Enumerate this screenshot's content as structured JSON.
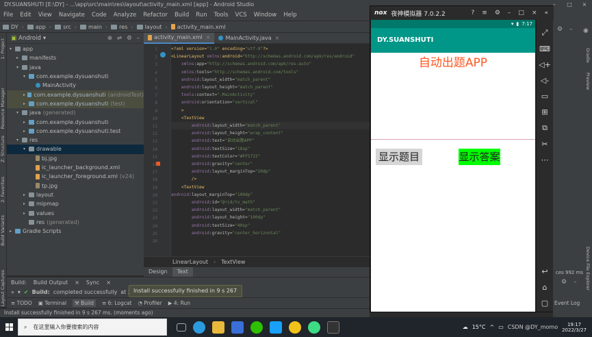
{
  "window": {
    "title": "DY.SUANSHUTI [E:\\DY] - ...\\app\\src\\main\\res\\layout\\activity_main.xml [app] - Android Studio"
  },
  "menu": [
    "File",
    "Edit",
    "View",
    "Navigate",
    "Code",
    "Analyze",
    "Refactor",
    "Build",
    "Run",
    "Tools",
    "VCS",
    "Window",
    "Help"
  ],
  "breadcrumbs": [
    "DY",
    "app",
    "src",
    "main",
    "res",
    "layout",
    "activity_main.xml"
  ],
  "run_config": {
    "module": "app",
    "device": "samsu"
  },
  "left_tools": [
    "1: Project",
    "Resource Manager",
    "Z: Structure",
    "2: Favorites",
    "Build Variants",
    "Layout Captures"
  ],
  "project": {
    "view": "Android",
    "items": [
      {
        "label": "app"
      },
      {
        "label": "manifests"
      },
      {
        "label": "java"
      },
      {
        "label": "com.example.dysuanshuti"
      },
      {
        "label": "MainActivity"
      },
      {
        "label": "com.example.dysuanshuti",
        "suffix": "(androidTest)"
      },
      {
        "label": "com.example.dysuanshuti",
        "suffix": "(test)"
      },
      {
        "label": "java",
        "suffix": "(generated)"
      },
      {
        "label": "com.example.dysuanshuti"
      },
      {
        "label": "com.example.dysuanshuti.test"
      },
      {
        "label": "res"
      },
      {
        "label": "drawable"
      },
      {
        "label": "bj.jpg"
      },
      {
        "label": "ic_launcher_background.xml"
      },
      {
        "label": "ic_launcher_foreground.xml",
        "suffix": "(v24)"
      },
      {
        "label": "tp.jpg"
      },
      {
        "label": "layout"
      },
      {
        "label": "mipmap"
      },
      {
        "label": "values"
      },
      {
        "label": "res",
        "suffix": "(generated)"
      },
      {
        "label": "Gradle Scripts"
      }
    ]
  },
  "editor": {
    "tabs": [
      {
        "label": "activity_main.xml"
      },
      {
        "label": "MainActivity.java"
      }
    ],
    "line_numbers": [
      "1",
      "2",
      "3",
      "4",
      "5",
      "6",
      "7",
      "8",
      "9",
      "10",
      "11",
      "12",
      "13",
      "14",
      "15",
      "16",
      "17",
      "18",
      "19",
      "20",
      "21",
      "22",
      "23",
      "24",
      "25",
      "26"
    ],
    "code_lines": [
      "<?xml version=\"1.0\" encoding=\"utf-8\"?>",
      "<LinearLayout xmlns:android=\"http://schemas.android.com/apk/res/android\"",
      "    xmlns:app=\"http://schemas.android.com/apk/res-auto\"",
      "    xmlns:tools=\"http://schemas.android.com/tools\"",
      "    android:layout_width=\"match_parent\"",
      "    android:layout_height=\"match_parent\"",
      "    tools:context=\".MainActivity\"",
      "    android:orientation=\"vertical\"",
      "    >",
      "    <TextView",
      "        android:layout_width=\"match_parent\"",
      "        android:layout_height=\"wrap_content\"",
      "        android:text=\"自动出题APP\"",
      "        android:textSize=\"18sp\"",
      "        android:textColor=\"#FF5722\"",
      "        android:gravity=\"center\"",
      "        android:layout_marginTop=\"20dp\"",
      "        />",
      "    <TextView",
      "android:layout_marginTop=\"100dp\"",
      "        android:id=\"@+id/tv_math\"",
      "        android:layout_width=\"match_parent\"",
      "        android:layout_height=\"100dp\"",
      "        android:textSize=\"40sp\"",
      "        android:gravity=\"center_horizontal\""
    ],
    "breadcrumb": [
      "LinearLayout",
      "TextView"
    ],
    "modes": [
      "Design",
      "Text"
    ]
  },
  "build": {
    "header": [
      "Build:",
      "Build Output",
      "Sync"
    ],
    "status_prefix": "Build:",
    "status": "completed successfully",
    "status_tail": "at 20"
  },
  "toast": "Install successfully finished in 9 s 267 ms.",
  "bottom_tools": [
    "TODO",
    "Terminal",
    "Build",
    "6: Logcat",
    "Profiler",
    "4: Run"
  ],
  "statusbar": "Install successfully finished in 9 s 267 ms. (moments ago)",
  "right_tools": [
    "Gradle",
    "Preview",
    "Device File Explorer"
  ],
  "right_bottom": {
    "event_log": "Event Log",
    "extra": "ces 992 ms"
  },
  "emulator": {
    "brand": "nox",
    "title": "夜神模拟器 7.0.2.2",
    "time": "7:17",
    "app_title": "DY.SUANSHUTI",
    "headline": "自动出题APP",
    "btn_question": "显示题目",
    "btn_answer": "显示答案"
  },
  "taskbar": {
    "search_placeholder": "在这里输入你要搜索的内容",
    "weather": "15°C",
    "clock_time": "19:17",
    "clock_date": "2022/3/27",
    "watermark": "CSDN @DY_momo"
  },
  "colors": {
    "headline": "#FF5722",
    "appbar": "#009688",
    "answer_btn": "#00FF00"
  }
}
